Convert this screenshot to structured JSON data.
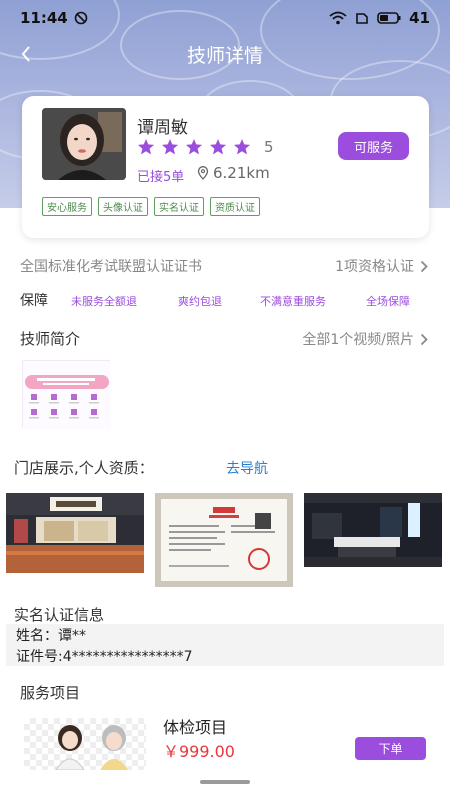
{
  "status_bar": {
    "time": "11:44",
    "battery": "41"
  },
  "nav": {
    "title": "技师详情"
  },
  "profile": {
    "name": "谭周敏",
    "rating": "5",
    "star_count": 5,
    "orders": "已接5单",
    "distance": "6.21km",
    "status_button": "可服务",
    "tags": [
      "安心服务",
      "头像认证",
      "实名认证",
      "资质认证"
    ]
  },
  "certificate": {
    "label": "全国标准化考试联盟认证证书",
    "value": "1项资格认证"
  },
  "guarantee": {
    "title": "保障",
    "items": [
      "未服务全额退",
      "爽约包退",
      "不满意重服务",
      "全场保障"
    ]
  },
  "intro": {
    "title": "技师简介",
    "more": "全部1个视频/照片"
  },
  "store": {
    "title": "门店展示,个人资质：",
    "nav_link": "去导航"
  },
  "realname": {
    "title": "实名认证信息",
    "name_line": "姓名：谭**",
    "id_line": "证件号:4****************7"
  },
  "services": {
    "title": "服务项目",
    "items": [
      {
        "name": "体检项目",
        "price": "￥999.00",
        "button": "下单"
      }
    ]
  },
  "colors": {
    "accent": "#9b4dde",
    "price": "#e8383d",
    "link": "#2a7fd4",
    "tag": "#4c8a4c"
  }
}
